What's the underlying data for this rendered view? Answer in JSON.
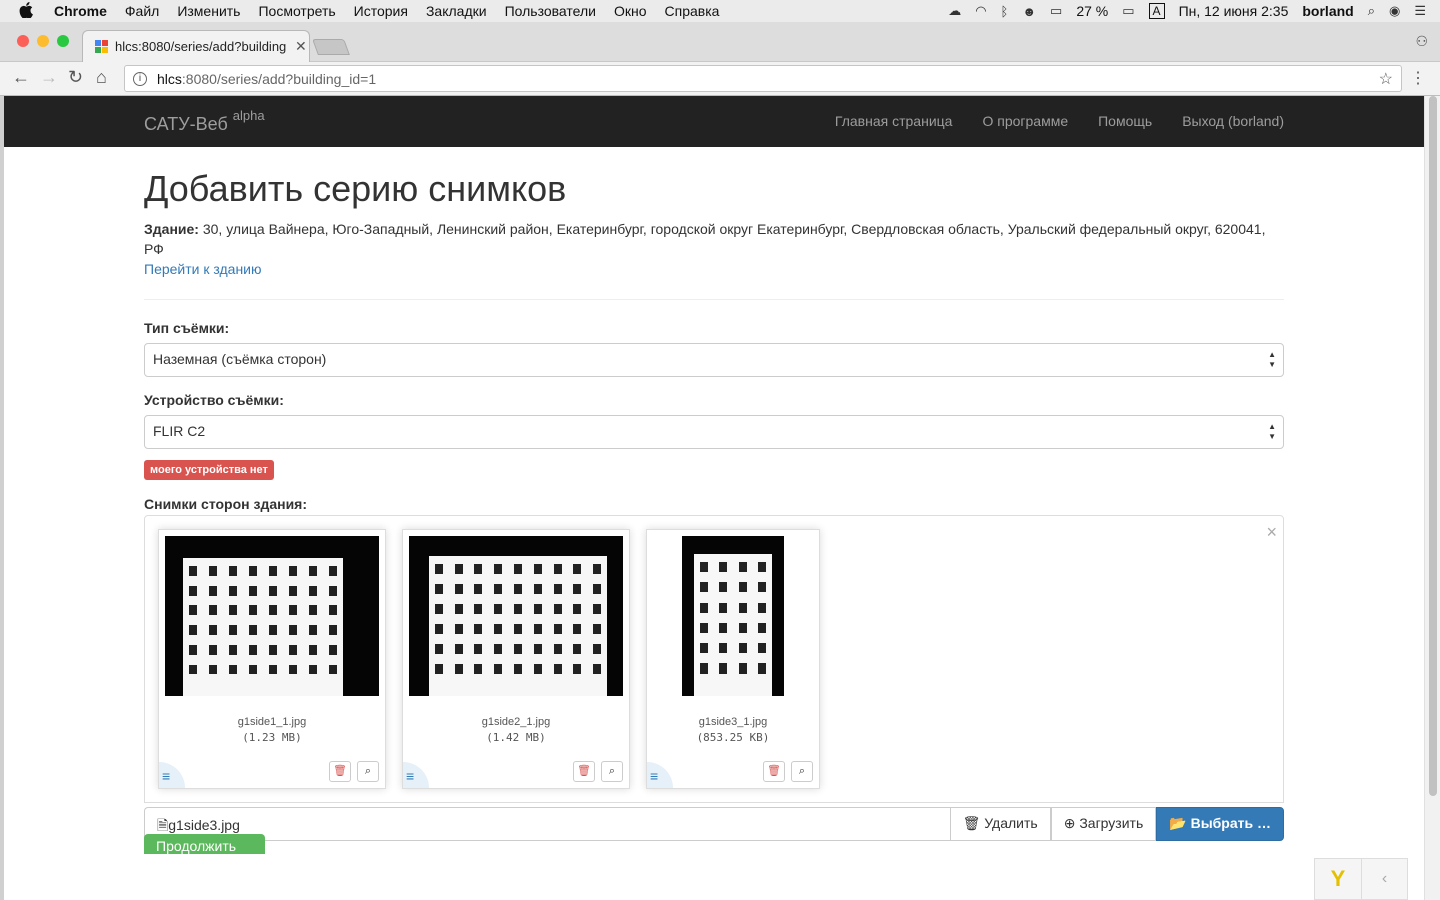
{
  "menubar": {
    "app": "Chrome",
    "items": [
      "Файл",
      "Изменить",
      "Посмотреть",
      "История",
      "Закладки",
      "Пользователи",
      "Окно",
      "Справка"
    ],
    "battery": "27 %",
    "input_source": "A",
    "datetime": "Пн, 12 июня  2:35",
    "user": "borland"
  },
  "browser": {
    "tab_title": "hlcs:8080/series/add?building",
    "url_host": "hlcs",
    "url_path": ":8080/series/add?building_id=1"
  },
  "navbar": {
    "brand": "САТУ-Веб",
    "brand_sup": "alpha",
    "links": [
      "Главная страница",
      "О программе",
      "Помощь",
      "Выход (borland)"
    ]
  },
  "main": {
    "title": "Добавить серию снимков",
    "building_label": "Здание:",
    "building_address": " 30, улица Вайнера, Юго-Западный, Ленинский район, Екатеринбург, городской округ Екатеринбург, Свердловская область, Уральский федеральный округ, 620041, РФ",
    "building_link": "Перейти к зданию",
    "shooting_type_label": "Тип съёмки:",
    "shooting_type_value": "Наземная (съёмка сторон)",
    "device_label": "Устройство съёмки:",
    "device_value": "FLIR C2",
    "no_device_badge": "моего устройства нет",
    "photos_label": "Снимки сторон здания:",
    "files": [
      {
        "name": "g1side1_1.jpg",
        "size": "(1.23 MB)"
      },
      {
        "name": "g1side2_1.jpg",
        "size": "(1.42 MB)"
      },
      {
        "name": "g1side3_1.jpg",
        "size": "(853.25 KB)"
      }
    ],
    "file_caption": "g1side3.jpg",
    "remove_button": "Удалить",
    "upload_button": "Загрузить",
    "browse_button": "Выбрать …",
    "submit_button": "Продолжить"
  }
}
